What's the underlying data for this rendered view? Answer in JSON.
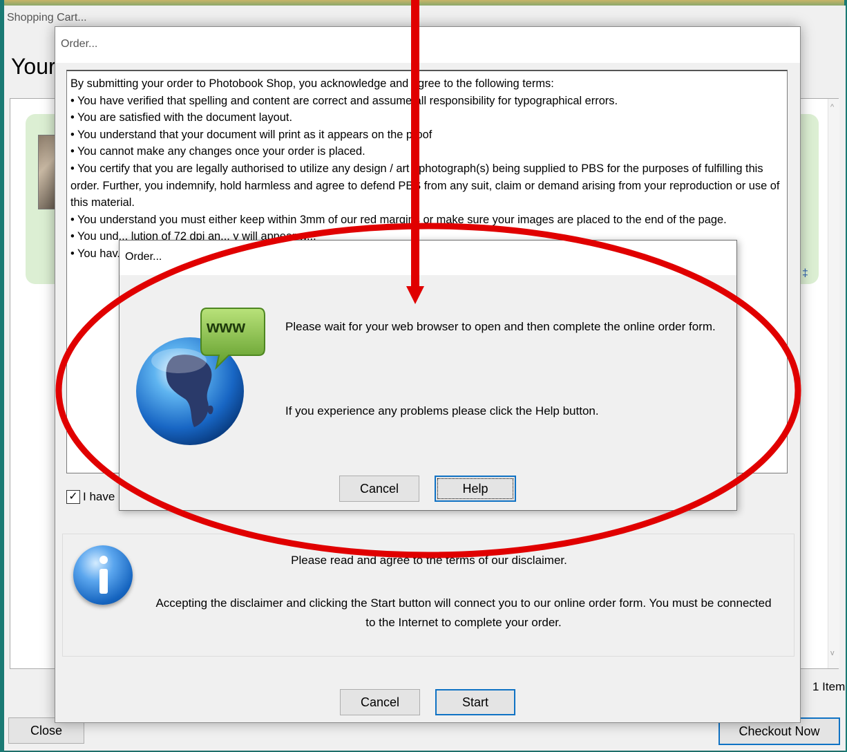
{
  "cart_window": {
    "title": "Shopping Cart...",
    "heading": "Your",
    "item_link_mark": "‡",
    "item_count": "1 Item",
    "close_label": "Close",
    "checkout_label": "Checkout Now"
  },
  "order_dialog": {
    "title": "Order...",
    "terms": [
      "By submitting your order to Photobook Shop, you acknowledge and agree to the following terms:",
      "• You have verified that spelling and content are correct and assume all responsibility for typographical errors.",
      "• You are satisfied with the document layout.",
      "• You understand that your document will print as it appears on the proof",
      "• You cannot make any changes once your order is placed.",
      "• You certify that you are legally authorised to utilize any design / art / photograph(s) being supplied to PBS for the purposes of fulfilling this order. Further, you indemnify, hold harmless and agree to defend PBS from any suit, claim or demand arising from your reproduction or use of this material.",
      "• You understand you must either keep within 3mm of our red margins or make sure your images are placed to the end of the page.",
      "• You und... lution of 72 dpi an... y will appear w...",
      "• You hav..."
    ],
    "agree_label": "I have",
    "agree_checked": true,
    "info_title": "Please read and agree to the terms of our disclaimer.",
    "info_body": "Accepting the disclaimer and clicking the Start button will connect you to our online order form. You must be connected to the Internet to complete your order.",
    "cancel_label": "Cancel",
    "start_label": "Start"
  },
  "wait_dialog": {
    "title": "Order...",
    "icon_text": "www",
    "message1": "Please wait for your web browser to open and then complete the online order form.",
    "message2": "If you experience any problems please click the Help button.",
    "cancel_label": "Cancel",
    "help_label": "Help"
  },
  "colors": {
    "annotation": "#e00000",
    "accent": "#0f72c4",
    "cart_item_bg": "#dcefd3"
  },
  "icons": [
    "info-icon",
    "globe-www-icon",
    "checkbox-check-icon",
    "scroll-up-arrow-icon",
    "scroll-down-arrow-icon"
  ]
}
